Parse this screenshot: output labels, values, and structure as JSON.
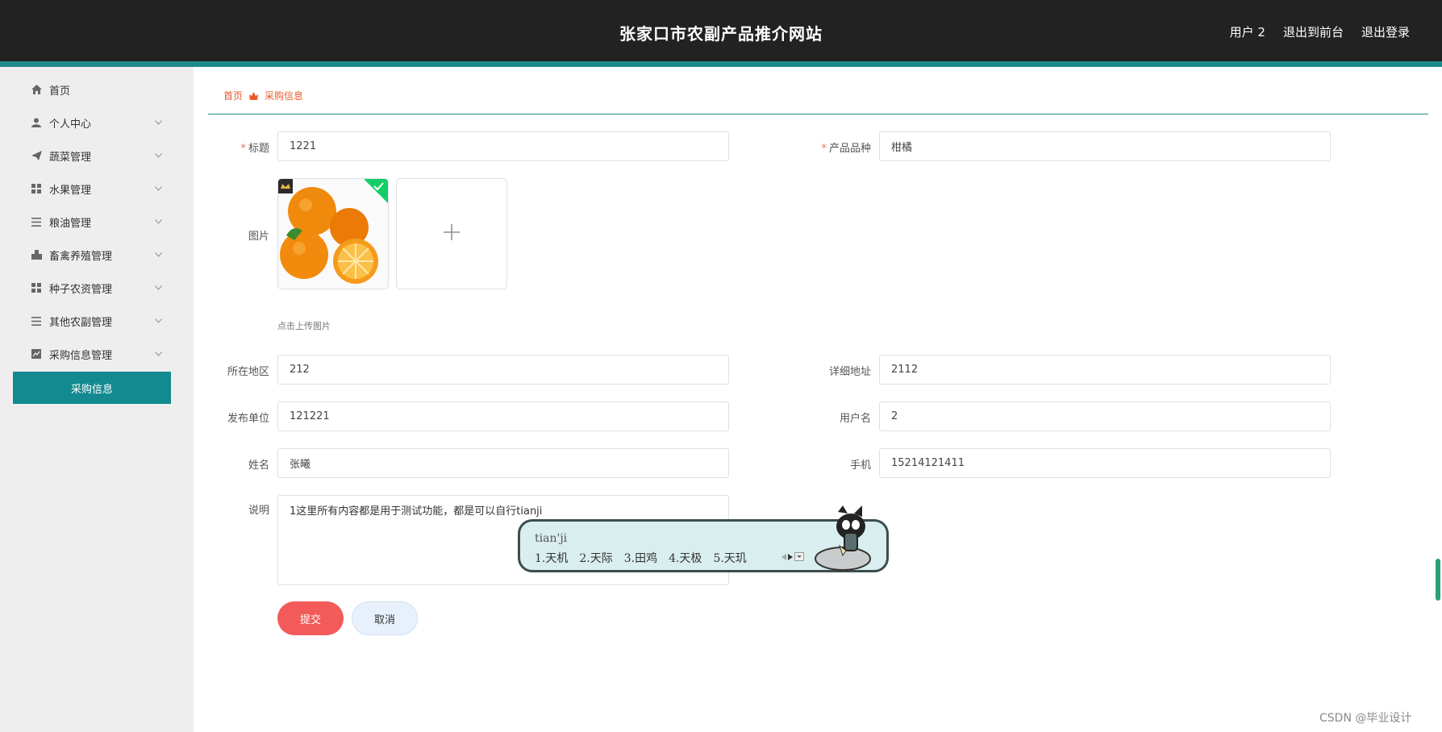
{
  "header": {
    "title": "张家口市农副产品推介网站",
    "links": [
      {
        "label": "用户 2"
      },
      {
        "label": "退出到前台"
      },
      {
        "label": "退出登录"
      }
    ]
  },
  "sidebar": {
    "items": [
      {
        "label": "首页",
        "icon": "home-icon"
      },
      {
        "label": "个人中心",
        "icon": "user-icon"
      },
      {
        "label": "蔬菜管理",
        "icon": "send-icon"
      },
      {
        "label": "水果管理",
        "icon": "grid-icon"
      },
      {
        "label": "粮油管理",
        "icon": "list-icon"
      },
      {
        "label": "畜禽养殖管理",
        "icon": "stamp-icon"
      },
      {
        "label": "种子农资管理",
        "icon": "grid-icon"
      },
      {
        "label": "其他农副管理",
        "icon": "list-icon"
      },
      {
        "label": "采购信息管理",
        "icon": "chart-icon"
      }
    ],
    "active_sub": "采购信息"
  },
  "breadcrumb": {
    "home": "首页",
    "current": "采购信息"
  },
  "form": {
    "title_label": "标题",
    "title_value": "1221",
    "variety_label": "产品品种",
    "variety_value": "柑橘",
    "image_label": "图片",
    "upload_hint": "点击上传图片",
    "region_label": "所在地区",
    "region_value": "212",
    "address_label": "详细地址",
    "address_value": "2112",
    "publisher_label": "发布单位",
    "publisher_value": "121221",
    "username_label": "用户名",
    "username_value": "2",
    "name_label": "姓名",
    "name_value": "张曦",
    "phone_label": "手机",
    "phone_value": "15214121411",
    "desc_label": "说明",
    "desc_value": "1这里所有内容都是用于测试功能，都是可以自行tianji",
    "submit_label": "提交",
    "cancel_label": "取消"
  },
  "ime": {
    "pinyin": "tian'ji",
    "candidates": [
      "1.天机",
      "2.天际",
      "3.田鸡",
      "4.天极",
      "5.天玑"
    ]
  },
  "watermark": "CSDN @毕业设计",
  "colors": {
    "topbar": "#222222",
    "accent": "#1f8a8a",
    "sidebar_active": "#138a8f",
    "breadcrumb": "#e85a2a",
    "submit": "#f35b5b"
  }
}
